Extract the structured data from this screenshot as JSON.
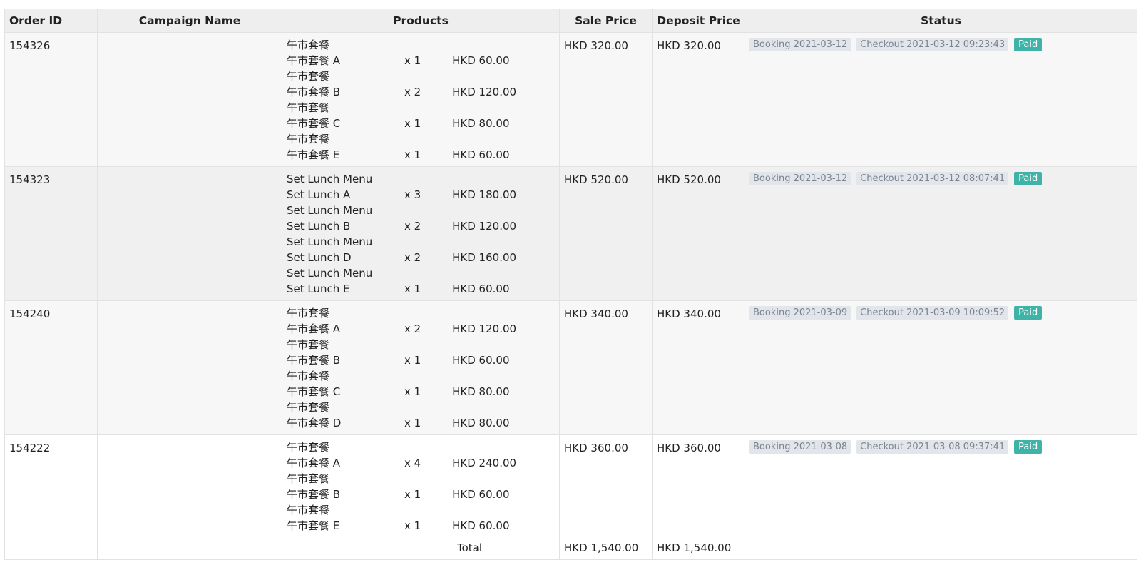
{
  "columns": {
    "order_id": "Order ID",
    "campaign": "Campaign Name",
    "products": "Products",
    "sale": "Sale Price",
    "deposit": "Deposit Price",
    "status": "Status"
  },
  "orders": [
    {
      "id": "154326",
      "campaign": "",
      "products": [
        {
          "menu": "午市套餐",
          "name": "午市套餐 A",
          "qty": "x 1",
          "price": "HKD 60.00"
        },
        {
          "menu": "午市套餐",
          "name": "午市套餐 B",
          "qty": "x 2",
          "price": "HKD 120.00"
        },
        {
          "menu": "午市套餐",
          "name": "午市套餐 C",
          "qty": "x 1",
          "price": "HKD 80.00"
        },
        {
          "menu": "午市套餐",
          "name": "午市套餐 E",
          "qty": "x 1",
          "price": "HKD 60.00"
        }
      ],
      "sale": "HKD 320.00",
      "deposit": "HKD 320.00",
      "booking": "Booking 2021-03-12",
      "checkout": "Checkout 2021-03-12 09:23:43",
      "status": "Paid"
    },
    {
      "id": "154323",
      "campaign": "",
      "products": [
        {
          "menu": "Set Lunch Menu",
          "name": "Set Lunch A",
          "qty": "x 3",
          "price": "HKD 180.00"
        },
        {
          "menu": "Set Lunch Menu",
          "name": "Set Lunch B",
          "qty": "x 2",
          "price": "HKD 120.00"
        },
        {
          "menu": "Set Lunch Menu",
          "name": "Set Lunch D",
          "qty": "x 2",
          "price": "HKD 160.00"
        },
        {
          "menu": "Set Lunch Menu",
          "name": "Set Lunch E",
          "qty": "x 1",
          "price": "HKD 60.00"
        }
      ],
      "sale": "HKD 520.00",
      "deposit": "HKD 520.00",
      "booking": "Booking 2021-03-12",
      "checkout": "Checkout 2021-03-12 08:07:41",
      "status": "Paid"
    },
    {
      "id": "154240",
      "campaign": "",
      "products": [
        {
          "menu": "午市套餐",
          "name": "午市套餐 A",
          "qty": "x 2",
          "price": "HKD 120.00"
        },
        {
          "menu": "午市套餐",
          "name": "午市套餐 B",
          "qty": "x 1",
          "price": "HKD 60.00"
        },
        {
          "menu": "午市套餐",
          "name": "午市套餐 C",
          "qty": "x 1",
          "price": "HKD 80.00"
        },
        {
          "menu": "午市套餐",
          "name": "午市套餐 D",
          "qty": "x 1",
          "price": "HKD 80.00"
        }
      ],
      "sale": "HKD 340.00",
      "deposit": "HKD 340.00",
      "booking": "Booking 2021-03-09",
      "checkout": "Checkout 2021-03-09 10:09:52",
      "status": "Paid"
    },
    {
      "id": "154222",
      "campaign": "",
      "products": [
        {
          "menu": "午市套餐",
          "name": "午市套餐 A",
          "qty": "x 4",
          "price": "HKD 240.00"
        },
        {
          "menu": "午市套餐",
          "name": "午市套餐 B",
          "qty": "x 1",
          "price": "HKD 60.00"
        },
        {
          "menu": "午市套餐",
          "name": "午市套餐 E",
          "qty": "x 1",
          "price": "HKD 60.00"
        }
      ],
      "sale": "HKD 360.00",
      "deposit": "HKD 360.00",
      "booking": "Booking 2021-03-08",
      "checkout": "Checkout 2021-03-08 09:37:41",
      "status": "Paid"
    }
  ],
  "total": {
    "label": "Total",
    "sale": "HKD 1,540.00",
    "deposit": "HKD 1,540.00"
  },
  "colors": {
    "paid_badge": "#3fb3a8",
    "tag_bg": "#e2e5ea",
    "header_bg": "#eeeeee"
  }
}
